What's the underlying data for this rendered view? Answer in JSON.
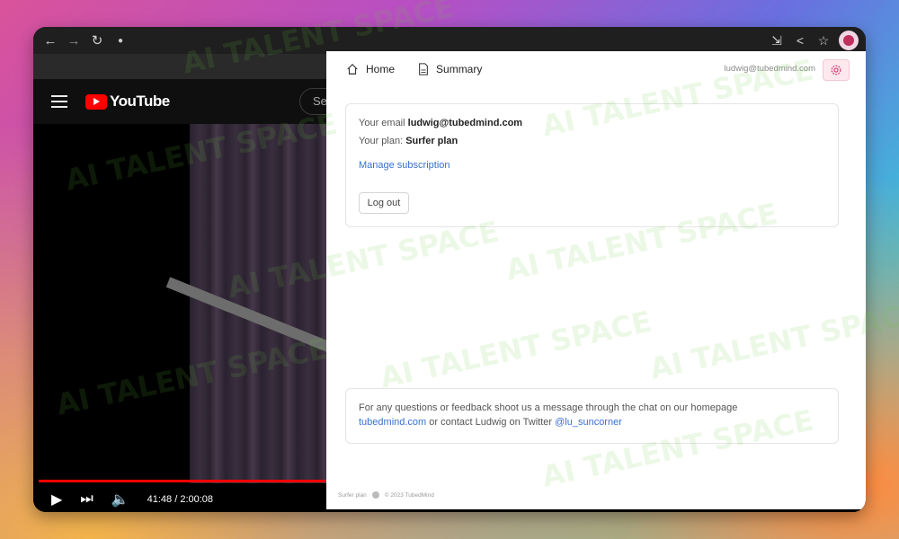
{
  "browser": {
    "nav_icons": [
      "back-icon",
      "forward-icon",
      "reload-icon",
      "lock-icon"
    ],
    "toolbar_icons": [
      "install-app-icon",
      "share-icon",
      "bookmark-star-icon",
      "profile-avatar"
    ]
  },
  "youtube": {
    "logo_text": "YouTube",
    "search_placeholder": "Se",
    "time_display": "41:48 / 2:00:08",
    "progress_fraction": 0.348
  },
  "panel": {
    "nav": [
      {
        "label": "Home",
        "icon": "home-icon"
      },
      {
        "label": "Summary",
        "icon": "document-icon"
      }
    ],
    "user_email": "ludwig@tubedmind.com",
    "account": {
      "email_prefix": "Your email",
      "email_value": "ludwig@tubedmind.com",
      "plan_prefix": "Your plan:",
      "plan_value": "Surfer plan",
      "manage_link": "Manage subscription",
      "logout_label": "Log out"
    },
    "feedback": {
      "text_1": "For any questions or feedback shoot us a message through the chat on our homepage",
      "homepage_link": "tubedmind.com",
      "text_2": "or contact Ludwig on Twitter",
      "twitter_link": "@lu_suncorner"
    },
    "footer": {
      "plan": "Surfer plan",
      "copyright": "© 2023 TubedMind"
    }
  },
  "watermark": {
    "text": "AI TALENT SPACE"
  },
  "colors": {
    "youtube_red": "#ff0000",
    "link_blue": "#3b6fd0",
    "settings_pink": "#fde8ee"
  }
}
